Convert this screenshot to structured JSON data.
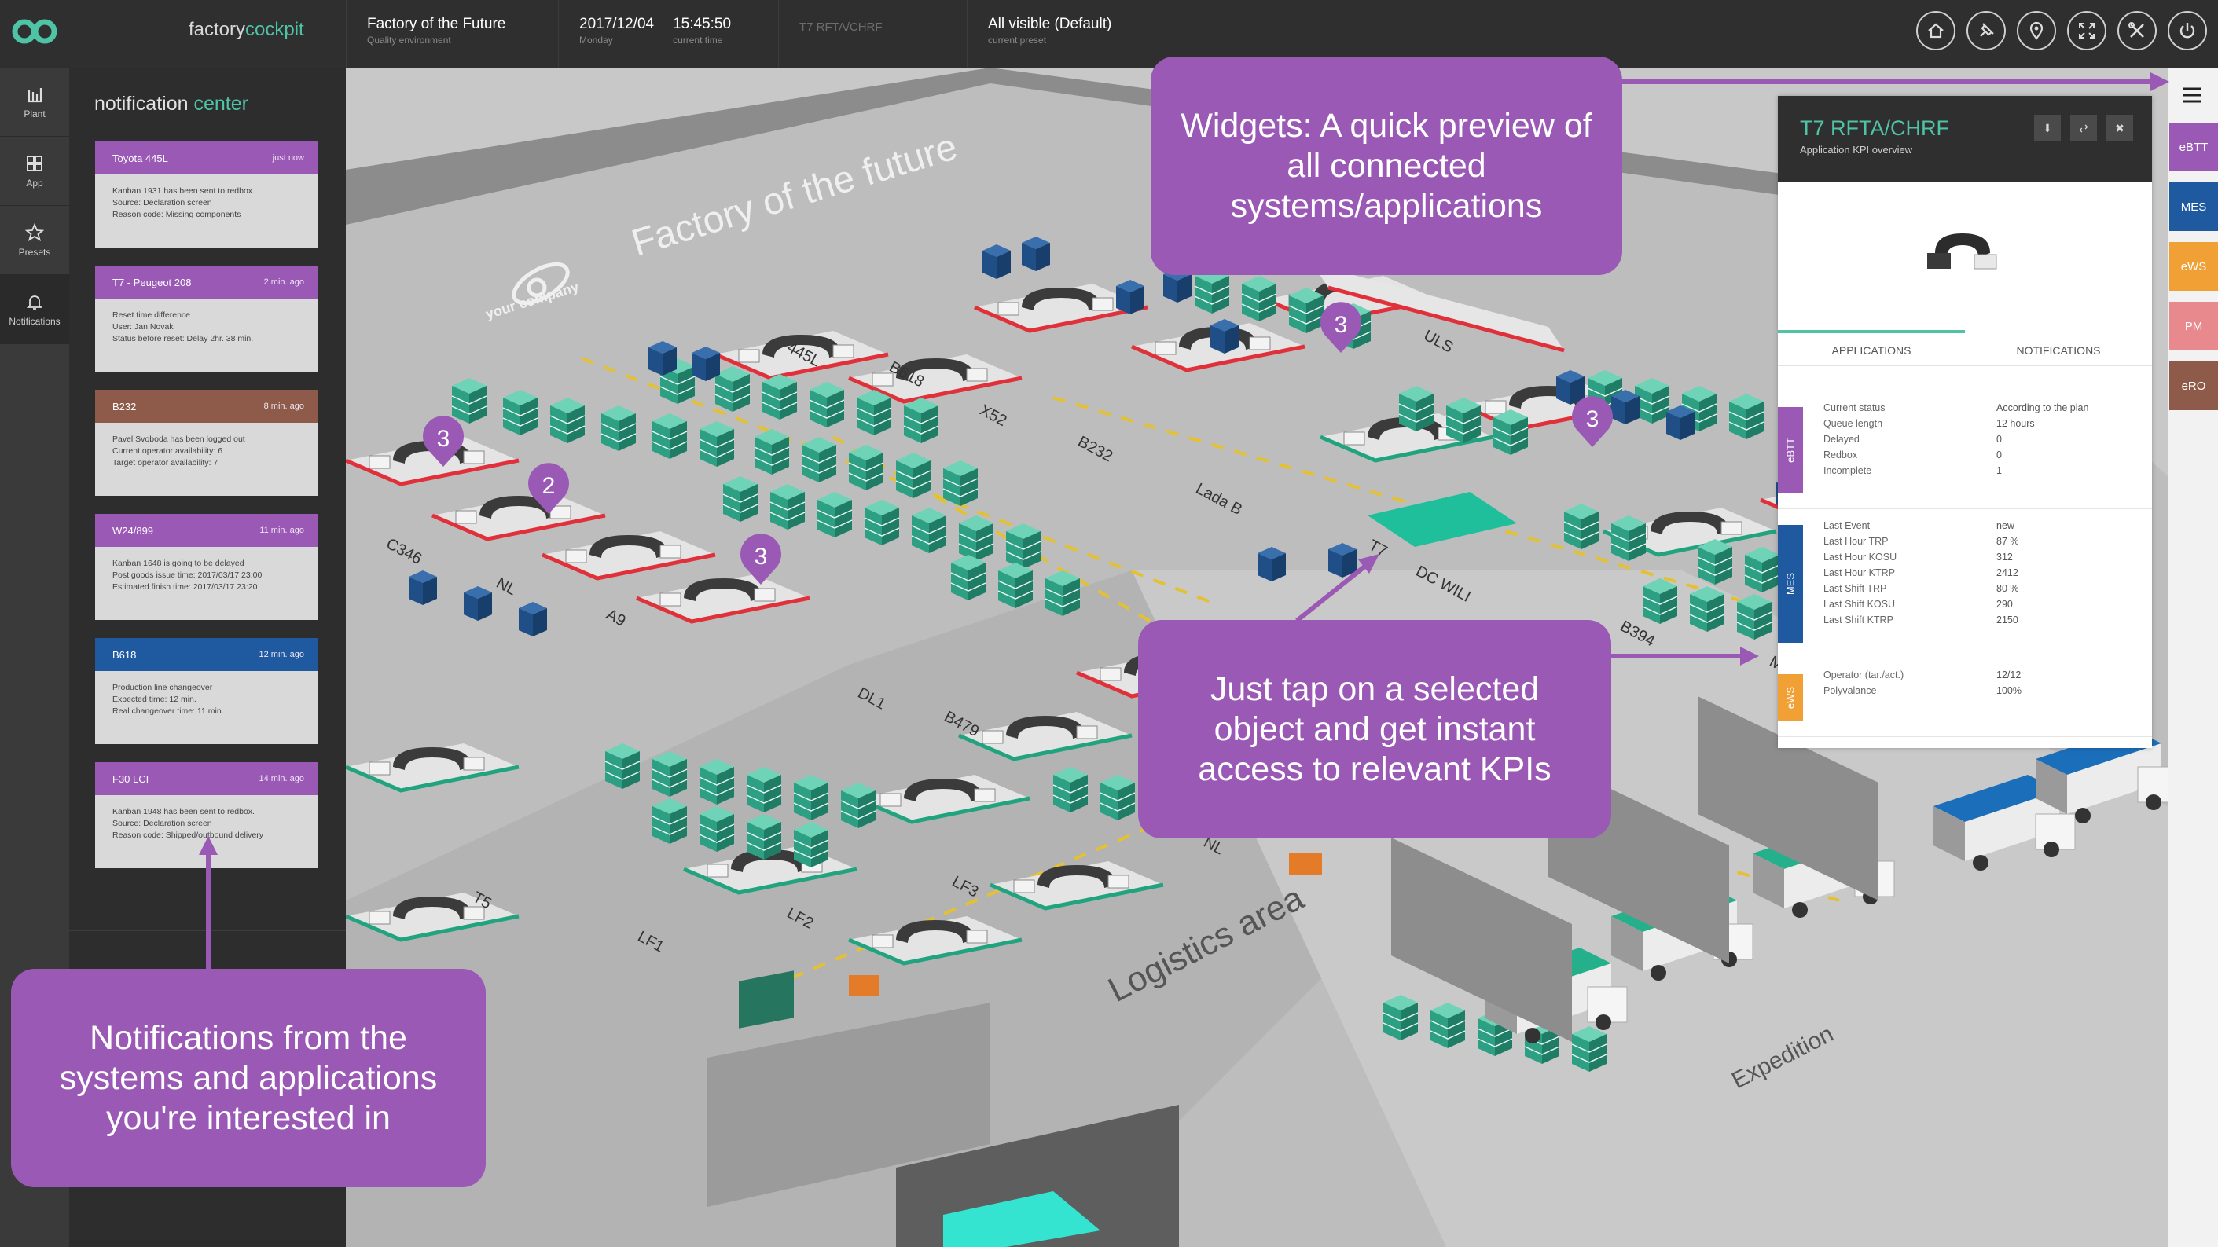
{
  "app": {
    "brand_main": "factory",
    "brand_accent": "cockpit"
  },
  "header": {
    "factory_name": "Factory of the Future",
    "factory_sub": "Quality environment",
    "date": "2017/12/04",
    "weekday": "Monday",
    "time": "15:45:50",
    "time_sub": "current time",
    "selection": "T7 RFTA/CHRF",
    "preset": "All visible (Default)",
    "preset_sub": "current preset",
    "icons": [
      "home-icon",
      "pin-icon",
      "location-icon",
      "fullscreen-icon",
      "tools-icon",
      "power-icon"
    ]
  },
  "rail": {
    "items": [
      {
        "label": "Plant",
        "icon": "plant-icon"
      },
      {
        "label": "App",
        "icon": "app-icon"
      },
      {
        "label": "Presets",
        "icon": "star-icon"
      },
      {
        "label": "Notifications",
        "icon": "bell-icon"
      }
    ]
  },
  "notifications": {
    "title_main": "notification",
    "title_accent": "center",
    "items": [
      {
        "title": "Toyota 445L",
        "time": "just now",
        "color": "#9b59b6",
        "lines": [
          "Kanban 1931 has been sent to redbox.",
          "Source: Declaration screen",
          "Reason code: Missing components"
        ]
      },
      {
        "title": "T7 - Peugeot 208",
        "time": "2 min. ago",
        "color": "#9b59b6",
        "lines": [
          "Reset time difference",
          "User: Jan Novak",
          "Status before reset: Delay 2hr. 38 min."
        ]
      },
      {
        "title": "B232",
        "time": "8 min. ago",
        "color": "#8e5b4a",
        "lines": [
          "Pavel Svoboda has been logged out",
          "Current operator availability: 6",
          "Target operator availability: 7"
        ]
      },
      {
        "title": "W24/899",
        "time": "11 min. ago",
        "color": "#9b59b6",
        "lines": [
          "Kanban 1648 is going to be delayed",
          "Post goods issue time: 2017/03/17 23:00",
          "Estimated finish time: 2017/03/17 23:20"
        ]
      },
      {
        "title": "B618",
        "time": "12 min. ago",
        "color": "#1f5aa0",
        "lines": [
          "Production line changeover",
          "Expected time: 12 min.",
          "Real changeover time: 11 min."
        ]
      },
      {
        "title": "F30 LCI",
        "time": "14 min. ago",
        "color": "#9b59b6",
        "lines": [
          "Kanban 1948 has been sent to redbox.",
          "Source: Declaration screen",
          "Reason code: Shipped/outbound delivery"
        ]
      }
    ]
  },
  "map": {
    "banner": "Factory of the future",
    "company": "your company",
    "logistics": "Logistics area",
    "expedition": "Expedition",
    "line_labels": [
      "445L",
      "B618",
      "X52",
      "B232",
      "Lada B",
      "ULS",
      "C346",
      "NL",
      "A9",
      "T7",
      "DC WILI",
      "B394",
      "DL1",
      "B479",
      "LF3",
      "LF2",
      "LF1",
      "T5",
      "NL",
      "MQB"
    ],
    "badges": [
      "3",
      "2",
      "3",
      "3",
      "3"
    ]
  },
  "widget": {
    "title": "T7 RFTA/CHRF",
    "subtitle": "Application KPI overview",
    "buttons": [
      "pin-icon",
      "swap-icon",
      "close-icon"
    ],
    "tabs": [
      "APPLICATIONS",
      "NOTIFICATIONS"
    ],
    "sections": [
      {
        "label": "eBTT",
        "color": "#9b59b6",
        "rows": [
          [
            "Current status",
            "According to the plan"
          ],
          [
            "Queue length",
            "12 hours"
          ],
          [
            "Delayed",
            "0"
          ],
          [
            "Redbox",
            "0"
          ],
          [
            "Incomplete",
            "1"
          ]
        ]
      },
      {
        "label": "MES",
        "color": "#1f5aa0",
        "rows": [
          [
            "Last Event",
            "new"
          ],
          [
            "Last Hour TRP",
            "87 %"
          ],
          [
            "Last Hour KOSU",
            "312"
          ],
          [
            "Last Hour KTRP",
            "2412"
          ],
          [
            "Last Shift TRP",
            "80 %"
          ],
          [
            "Last Shift KOSU",
            "290"
          ],
          [
            "Last Shift KTRP",
            "2150"
          ]
        ]
      },
      {
        "label": "eWS",
        "color": "#f0a035",
        "rows": [
          [
            "Operator (tar./act.)",
            "12/12"
          ],
          [
            "Polyvalance",
            "100%"
          ]
        ]
      }
    ]
  },
  "right_tabs": [
    {
      "label": "eBTT",
      "color": "#9b59b6"
    },
    {
      "label": "MES",
      "color": "#1f5aa0"
    },
    {
      "label": "eWS",
      "color": "#f0a035"
    },
    {
      "label": "PM",
      "color": "#e8898d"
    },
    {
      "label": "eRO",
      "color": "#8e5b4a"
    }
  ],
  "menu_icon": "hamburger-icon",
  "callouts": {
    "widgets": "Widgets: A quick preview of all connected systems/applications",
    "tap": "Just tap on a selected object and get instant access to relevant KPIs",
    "notifications": "Notifications from the systems and applications you're interested in"
  },
  "colors": {
    "accent": "#4fc3a6",
    "purple": "#9b59b6",
    "dark": "#2f2f2f",
    "red": "#e0303a"
  }
}
